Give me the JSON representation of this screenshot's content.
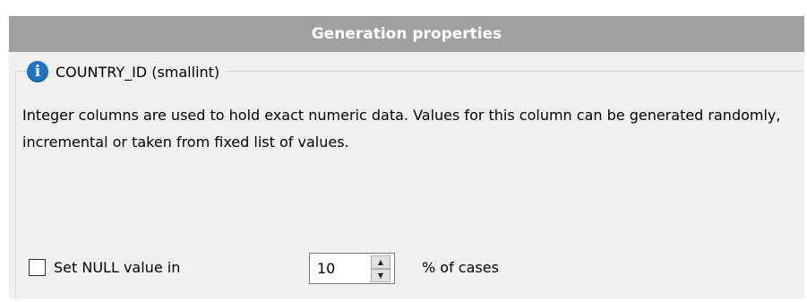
{
  "header": {
    "title": "Generation properties"
  },
  "column_group": {
    "icon": "info-icon",
    "icon_glyph": "i",
    "title": "COUNTRY_ID (smallint)",
    "description": "Integer columns are used to hold exact numeric data. Values for this column can be generated randomly, incremental or taken from fixed list of values."
  },
  "null_settings": {
    "checkbox_label": "Set NULL value in",
    "checked": false,
    "percent_value": "10",
    "suffix_label": "% of cases"
  },
  "colors": {
    "header_bg": "#a0a0a0",
    "panel_bg": "#f0f0f0",
    "info_icon": "#1f72c4"
  }
}
